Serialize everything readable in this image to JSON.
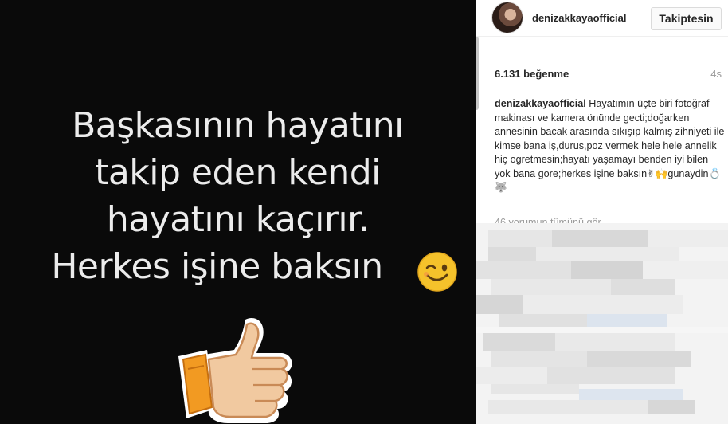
{
  "post": {
    "image": {
      "quote_lines": [
        "Başkasının hayatını",
        "takip eden kendi",
        "hayatını kaçırır.",
        "Herkes işine baksın"
      ],
      "wink_emoji": "winking-face-icon",
      "thumb_emoji": "thumbs-up-icon"
    },
    "header": {
      "username": "denizakkayaofficial",
      "follow_button": "Takiptesin"
    },
    "likes": "6.131 beğenme",
    "time": "4s",
    "caption": {
      "username": "denizakkayaofficial",
      "text": "Hayatımın üçte biri fotoğraf makinası ve kamera önünde gecti;doğarken annesinin bacak arasında sıkışıp kalmış zihniyeti ile kimse bana iş,durus,poz vermek hele hele annelik hiç ogretmesin;hayatı yaşamayı benden iyi bilen yok bana gore;herkes işine baksın✌🙌gunaydin💍🐺"
    },
    "view_all_comments": "46 yorumun tümünü gör"
  },
  "colors": {
    "image_bg": "#0a0a0a",
    "quote_text": "#ececec",
    "secondary_text": "#999999",
    "primary_text": "#262626"
  }
}
